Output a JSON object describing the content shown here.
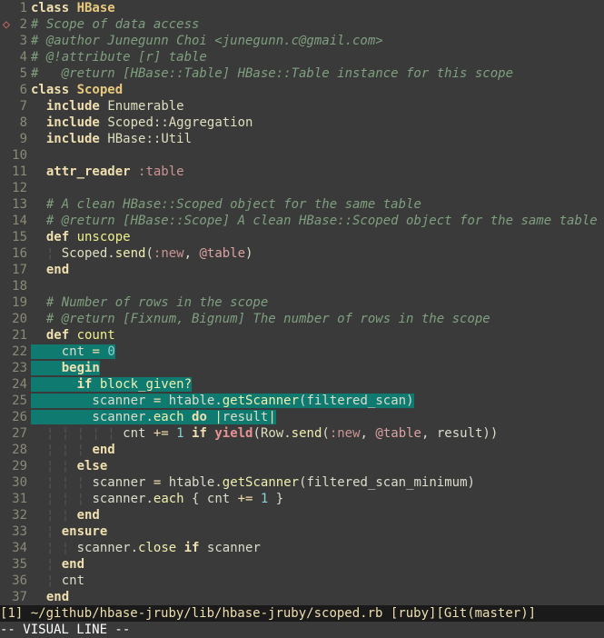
{
  "sign_line": 2,
  "lines": [
    {
      "n": 1,
      "sel": false,
      "tokens": [
        {
          "c": "kw",
          "t": "class "
        },
        {
          "c": "clsb",
          "t": "HBase"
        }
      ]
    },
    {
      "n": 2,
      "sel": false,
      "tokens": [
        {
          "c": "cmt",
          "t": "# Scope of data access"
        }
      ]
    },
    {
      "n": 3,
      "sel": false,
      "tokens": [
        {
          "c": "cmt",
          "t": "# @author Junegunn Choi <junegunn.c@gmail.com>"
        }
      ]
    },
    {
      "n": 4,
      "sel": false,
      "tokens": [
        {
          "c": "cmt",
          "t": "# @!attribute [r] table"
        }
      ]
    },
    {
      "n": 5,
      "sel": false,
      "tokens": [
        {
          "c": "cmt",
          "t": "#   @return [HBase::Table] HBase::Table instance for this scope"
        }
      ]
    },
    {
      "n": 6,
      "sel": false,
      "tokens": [
        {
          "c": "kw",
          "t": "class "
        },
        {
          "c": "clsb",
          "t": "Scoped"
        }
      ]
    },
    {
      "n": 7,
      "sel": false,
      "tokens": [
        {
          "c": "id",
          "t": "  "
        },
        {
          "c": "inc",
          "t": "include"
        },
        {
          "c": "id",
          "t": " "
        },
        {
          "c": "const",
          "t": "Enumerable"
        }
      ]
    },
    {
      "n": 8,
      "sel": false,
      "tokens": [
        {
          "c": "id",
          "t": "  "
        },
        {
          "c": "inc",
          "t": "include"
        },
        {
          "c": "id",
          "t": " "
        },
        {
          "c": "const",
          "t": "Scoped"
        },
        {
          "c": "punct",
          "t": "::"
        },
        {
          "c": "const",
          "t": "Aggregation"
        }
      ]
    },
    {
      "n": 9,
      "sel": false,
      "tokens": [
        {
          "c": "id",
          "t": "  "
        },
        {
          "c": "inc",
          "t": "include"
        },
        {
          "c": "id",
          "t": " "
        },
        {
          "c": "const",
          "t": "HBase"
        },
        {
          "c": "punct",
          "t": "::"
        },
        {
          "c": "const",
          "t": "Util"
        }
      ]
    },
    {
      "n": 10,
      "sel": false,
      "tokens": []
    },
    {
      "n": 11,
      "sel": false,
      "tokens": [
        {
          "c": "id",
          "t": "  "
        },
        {
          "c": "attr",
          "t": "attr_reader"
        },
        {
          "c": "id",
          "t": " "
        },
        {
          "c": "sym",
          "t": ":table"
        }
      ]
    },
    {
      "n": 12,
      "sel": false,
      "tokens": []
    },
    {
      "n": 13,
      "sel": false,
      "tokens": [
        {
          "c": "id",
          "t": "  "
        },
        {
          "c": "cmt",
          "t": "# A clean HBase::Scoped object for the same table"
        }
      ]
    },
    {
      "n": 14,
      "sel": false,
      "tokens": [
        {
          "c": "id",
          "t": "  "
        },
        {
          "c": "cmt",
          "t": "# @return [HBase::Scope] A clean HBase::Scoped object for the same table"
        }
      ]
    },
    {
      "n": 15,
      "sel": false,
      "tokens": [
        {
          "c": "id",
          "t": "  "
        },
        {
          "c": "kw",
          "t": "def "
        },
        {
          "c": "mdef",
          "t": "unscope"
        }
      ]
    },
    {
      "n": 16,
      "sel": false,
      "tokens": [
        {
          "c": "id",
          "t": "  "
        },
        {
          "c": "indent",
          "t": "¦ "
        },
        {
          "c": "const",
          "t": "Scoped"
        },
        {
          "c": "punct",
          "t": "."
        },
        {
          "c": "call",
          "t": "send"
        },
        {
          "c": "punct",
          "t": "("
        },
        {
          "c": "sym",
          "t": ":new"
        },
        {
          "c": "punct",
          "t": ", "
        },
        {
          "c": "ivar",
          "t": "@table"
        },
        {
          "c": "punct",
          "t": ")"
        }
      ]
    },
    {
      "n": 17,
      "sel": false,
      "tokens": [
        {
          "c": "id",
          "t": "  "
        },
        {
          "c": "kw",
          "t": "end"
        }
      ]
    },
    {
      "n": 18,
      "sel": false,
      "tokens": []
    },
    {
      "n": 19,
      "sel": false,
      "tokens": [
        {
          "c": "id",
          "t": "  "
        },
        {
          "c": "cmt",
          "t": "# Number of rows in the scope"
        }
      ]
    },
    {
      "n": 20,
      "sel": false,
      "tokens": [
        {
          "c": "id",
          "t": "  "
        },
        {
          "c": "cmt",
          "t": "# @return [Fixnum, Bignum] The number of rows in the scope"
        }
      ]
    },
    {
      "n": 21,
      "sel": false,
      "tokens": [
        {
          "c": "id",
          "t": "  "
        },
        {
          "c": "kw",
          "t": "def "
        },
        {
          "c": "mdef",
          "t": "count"
        }
      ]
    },
    {
      "n": 22,
      "sel": true,
      "tokens": [
        {
          "c": "id",
          "t": "    cnt "
        },
        {
          "c": "op",
          "t": "="
        },
        {
          "c": "id",
          "t": " "
        },
        {
          "c": "num",
          "t": "0"
        }
      ]
    },
    {
      "n": 23,
      "sel": true,
      "tokens": [
        {
          "c": "id",
          "t": "    "
        },
        {
          "c": "kw",
          "t": "begin"
        }
      ]
    },
    {
      "n": 24,
      "sel": true,
      "tokens": [
        {
          "c": "id",
          "t": "      "
        },
        {
          "c": "kw",
          "t": "if"
        },
        {
          "c": "id",
          "t": " "
        },
        {
          "c": "call",
          "t": "block_given?"
        }
      ]
    },
    {
      "n": 25,
      "sel": true,
      "tokens": [
        {
          "c": "id",
          "t": "        scanner "
        },
        {
          "c": "op",
          "t": "="
        },
        {
          "c": "id",
          "t": " htable"
        },
        {
          "c": "punct",
          "t": "."
        },
        {
          "c": "call",
          "t": "getScanner"
        },
        {
          "c": "punct",
          "t": "("
        },
        {
          "c": "id",
          "t": "filtered_scan"
        },
        {
          "c": "punct",
          "t": ")"
        }
      ]
    },
    {
      "n": 26,
      "sel": true,
      "tokens": [
        {
          "c": "id",
          "t": "        scanner"
        },
        {
          "c": "punct",
          "t": "."
        },
        {
          "c": "call",
          "t": "each"
        },
        {
          "c": "id",
          "t": " "
        },
        {
          "c": "kw",
          "t": "do"
        },
        {
          "c": "id",
          "t": " "
        },
        {
          "c": "bar",
          "t": "|"
        },
        {
          "c": "id",
          "t": "result"
        },
        {
          "c": "bar",
          "t": "|"
        }
      ]
    },
    {
      "n": 27,
      "sel": false,
      "tokens": [
        {
          "c": "id",
          "t": "  "
        },
        {
          "c": "indent",
          "t": "¦ ¦ ¦ ¦ ¦ "
        },
        {
          "c": "id",
          "t": "cnt "
        },
        {
          "c": "op",
          "t": "+="
        },
        {
          "c": "id",
          "t": " "
        },
        {
          "c": "num",
          "t": "1"
        },
        {
          "c": "id",
          "t": " "
        },
        {
          "c": "kw",
          "t": "if"
        },
        {
          "c": "id",
          "t": " "
        },
        {
          "c": "yield",
          "t": "yield"
        },
        {
          "c": "punct",
          "t": "("
        },
        {
          "c": "const",
          "t": "Row"
        },
        {
          "c": "punct",
          "t": "."
        },
        {
          "c": "call",
          "t": "send"
        },
        {
          "c": "punct",
          "t": "("
        },
        {
          "c": "sym",
          "t": ":new"
        },
        {
          "c": "punct",
          "t": ", "
        },
        {
          "c": "ivar",
          "t": "@table"
        },
        {
          "c": "punct",
          "t": ", "
        },
        {
          "c": "id",
          "t": "result"
        },
        {
          "c": "punct",
          "t": "))"
        }
      ]
    },
    {
      "n": 28,
      "sel": false,
      "tokens": [
        {
          "c": "id",
          "t": "  "
        },
        {
          "c": "indent",
          "t": "¦ ¦ ¦ "
        },
        {
          "c": "kw",
          "t": "end"
        }
      ]
    },
    {
      "n": 29,
      "sel": false,
      "tokens": [
        {
          "c": "id",
          "t": "  "
        },
        {
          "c": "indent",
          "t": "¦ ¦ "
        },
        {
          "c": "kw",
          "t": "else"
        }
      ]
    },
    {
      "n": 30,
      "sel": false,
      "tokens": [
        {
          "c": "id",
          "t": "  "
        },
        {
          "c": "indent",
          "t": "¦ ¦ ¦ "
        },
        {
          "c": "id",
          "t": "scanner "
        },
        {
          "c": "op",
          "t": "="
        },
        {
          "c": "id",
          "t": " htable"
        },
        {
          "c": "punct",
          "t": "."
        },
        {
          "c": "call",
          "t": "getScanner"
        },
        {
          "c": "punct",
          "t": "("
        },
        {
          "c": "id",
          "t": "filtered_scan_minimum"
        },
        {
          "c": "punct",
          "t": ")"
        }
      ]
    },
    {
      "n": 31,
      "sel": false,
      "tokens": [
        {
          "c": "id",
          "t": "  "
        },
        {
          "c": "indent",
          "t": "¦ ¦ ¦ "
        },
        {
          "c": "id",
          "t": "scanner"
        },
        {
          "c": "punct",
          "t": "."
        },
        {
          "c": "call",
          "t": "each"
        },
        {
          "c": "id",
          "t": " "
        },
        {
          "c": "punct",
          "t": "{ "
        },
        {
          "c": "id",
          "t": "cnt "
        },
        {
          "c": "op",
          "t": "+="
        },
        {
          "c": "id",
          "t": " "
        },
        {
          "c": "num",
          "t": "1"
        },
        {
          "c": "punct",
          "t": " }"
        }
      ]
    },
    {
      "n": 32,
      "sel": false,
      "tokens": [
        {
          "c": "id",
          "t": "  "
        },
        {
          "c": "indent",
          "t": "¦ ¦ "
        },
        {
          "c": "kw",
          "t": "end"
        }
      ]
    },
    {
      "n": 33,
      "sel": false,
      "tokens": [
        {
          "c": "id",
          "t": "  "
        },
        {
          "c": "indent",
          "t": "¦ "
        },
        {
          "c": "kw",
          "t": "ensure"
        }
      ]
    },
    {
      "n": 34,
      "sel": false,
      "tokens": [
        {
          "c": "id",
          "t": "  "
        },
        {
          "c": "indent",
          "t": "¦ ¦ "
        },
        {
          "c": "id",
          "t": "scanner"
        },
        {
          "c": "punct",
          "t": "."
        },
        {
          "c": "call",
          "t": "close"
        },
        {
          "c": "id",
          "t": " "
        },
        {
          "c": "kw",
          "t": "if"
        },
        {
          "c": "id",
          "t": " scanner"
        }
      ]
    },
    {
      "n": 35,
      "sel": false,
      "tokens": [
        {
          "c": "id",
          "t": "  "
        },
        {
          "c": "indent",
          "t": "¦ "
        },
        {
          "c": "kw",
          "t": "end"
        }
      ]
    },
    {
      "n": 36,
      "sel": false,
      "tokens": [
        {
          "c": "id",
          "t": "  "
        },
        {
          "c": "indent",
          "t": "¦ "
        },
        {
          "c": "id",
          "t": "cnt"
        }
      ]
    },
    {
      "n": 37,
      "sel": false,
      "tokens": [
        {
          "c": "id",
          "t": "  "
        },
        {
          "c": "kw",
          "t": "end"
        }
      ]
    }
  ],
  "statusline": {
    "buf_num": "1",
    "path": "~/github/hbase-jruby/lib/hbase-jruby/scoped.rb",
    "filetype": "ruby",
    "vcs": "Git(master)"
  },
  "mode": "-- VISUAL LINE --"
}
